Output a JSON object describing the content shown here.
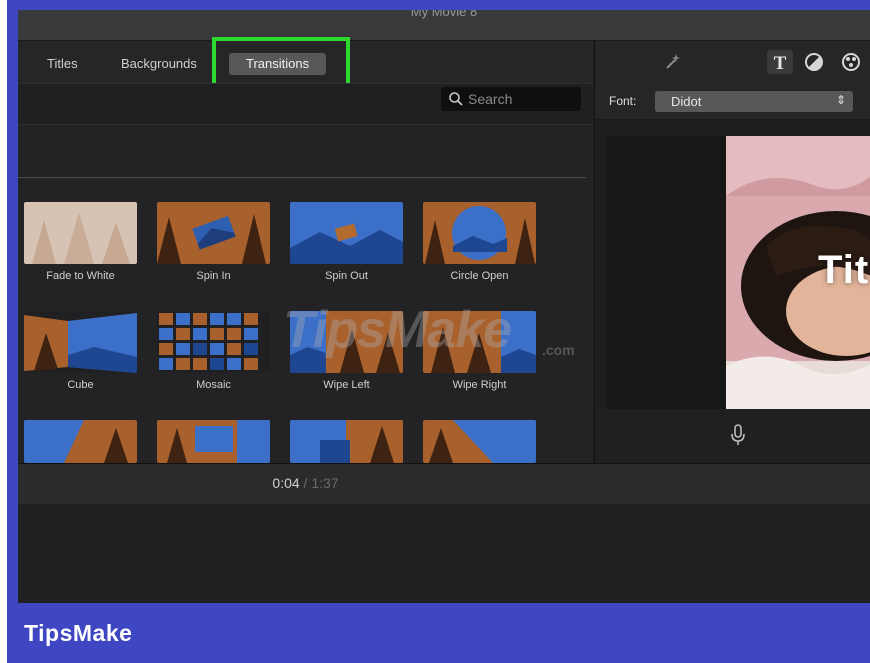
{
  "window": {
    "title": "My Movie 8"
  },
  "tabs": [
    {
      "label": "Titles"
    },
    {
      "label": "Backgrounds"
    },
    {
      "label": "Transitions",
      "active": true
    }
  ],
  "search": {
    "placeholder": "Search"
  },
  "transitions": [
    {
      "label": "Fade to White"
    },
    {
      "label": "Spin In"
    },
    {
      "label": "Spin Out"
    },
    {
      "label": "Circle Open"
    },
    {
      "label": "Cube"
    },
    {
      "label": "Mosaic"
    },
    {
      "label": "Wipe Left"
    },
    {
      "label": "Wipe Right"
    }
  ],
  "inspector": {
    "font_label": "Font:",
    "font_value": "Didot",
    "preview_title": "Tit"
  },
  "playback": {
    "current": "0:04",
    "separator": "/",
    "total": "1:37"
  },
  "watermark": {
    "text": "TipsMake",
    "suffix": ".com"
  },
  "brand": {
    "label": "TipsMake"
  },
  "colors": {
    "frame": "#3f46c2",
    "highlight": "#2ed82c",
    "app_bg": "#202022"
  }
}
